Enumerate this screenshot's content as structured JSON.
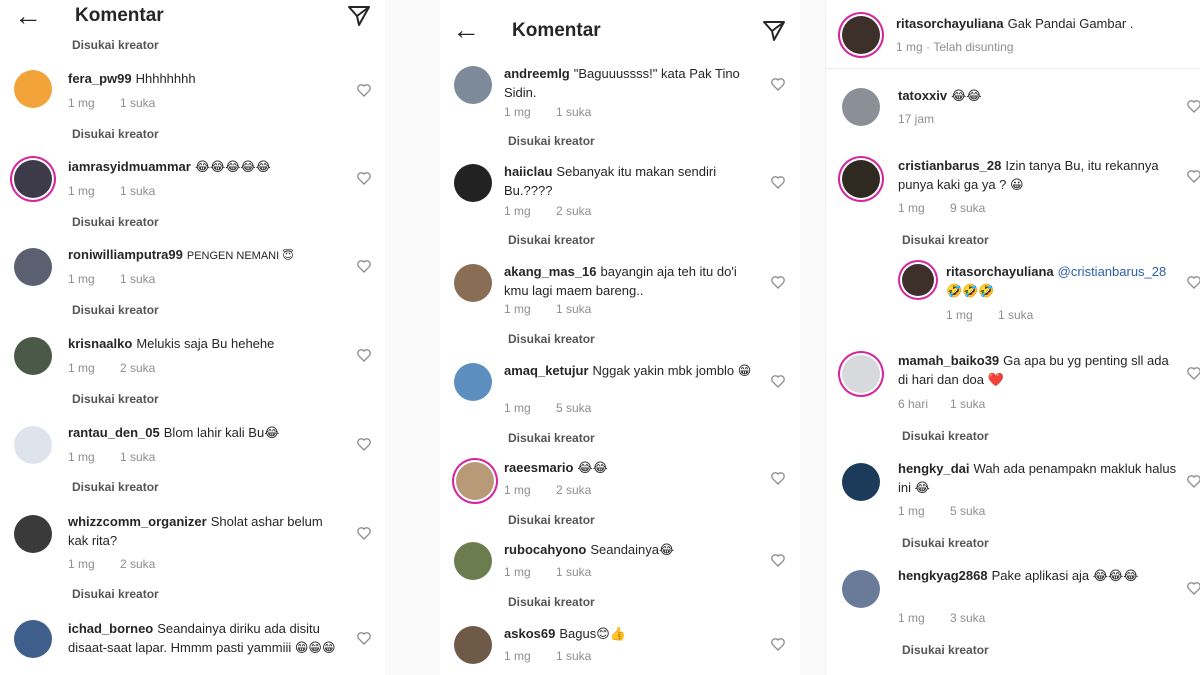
{
  "colors": {
    "text": "#262626",
    "muted": "#8e8e8e",
    "ring": "#d6249f"
  },
  "panel1": {
    "header": {
      "title": "Komentar",
      "back_icon": "arrow-left-icon",
      "send_icon": "send-icon"
    },
    "top_partial_label": "Disukai kreator",
    "comments": [
      {
        "username": "fera_pw99",
        "text": "Hhhhhhhh",
        "time": "1 mg",
        "likes": "1 suka",
        "liked_by_creator": "Disukai kreator"
      },
      {
        "username": "iamrasyidmuammar",
        "text": "😂😂😂😂😂",
        "time": "1 mg",
        "likes": "1 suka",
        "liked_by_creator": "Disukai kreator"
      },
      {
        "username": "roniwilliamputra99",
        "text": "PENGEN NEMANI 😇",
        "time": "1 mg",
        "likes": "1 suka",
        "liked_by_creator": "Disukai kreator"
      },
      {
        "username": "krisnaalko",
        "text": "Melukis saja Bu hehehe",
        "time": "1 mg",
        "likes": "2 suka",
        "liked_by_creator": "Disukai kreator"
      },
      {
        "username": "rantau_den_05",
        "text": "Blom lahir kali Bu😂",
        "time": "1 mg",
        "likes": "1 suka",
        "liked_by_creator": "Disukai kreator"
      },
      {
        "username": "whizzcomm_organizer",
        "text": "Sholat ashar belum kak rita?",
        "time": "1 mg",
        "likes": "2 suka",
        "liked_by_creator": "Disukai kreator"
      },
      {
        "username": "ichad_borneo",
        "text": "Seandainya diriku ada disitu disaat-saat lapar. Hmmm pasti yammiii 😁😁😁",
        "time": "",
        "likes": "",
        "liked_by_creator": ""
      }
    ]
  },
  "panel2": {
    "header": {
      "title": "Komentar",
      "back_icon": "arrow-left-icon",
      "send_icon": "send-icon"
    },
    "comments": [
      {
        "username": "andreemlg",
        "text": "\"Baguuussss!\" kata Pak Tino Sidin.",
        "time": "1 mg",
        "likes": "1 suka",
        "liked_by_creator": "Disukai kreator"
      },
      {
        "username": "haiiclau",
        "text": "Sebanyak itu makan sendiri Bu.????",
        "time": "1 mg",
        "likes": "2 suka",
        "liked_by_creator": "Disukai kreator"
      },
      {
        "username": "akang_mas_16",
        "text": "bayangin aja teh itu do'i kmu lagi maem bareng..",
        "time": "1 mg",
        "likes": "1 suka",
        "liked_by_creator": "Disukai kreator"
      },
      {
        "username": "amaq_ketujur",
        "text": "Nggak yakin mbk jomblo 😁",
        "time": "1 mg",
        "likes": "5 suka",
        "liked_by_creator": "Disukai kreator"
      },
      {
        "username": "raeesmario",
        "text": "😂😂",
        "time": "1 mg",
        "likes": "2 suka",
        "liked_by_creator": "Disukai kreator"
      },
      {
        "username": "rubocahyono",
        "text": "Seandainya😂",
        "time": "1 mg",
        "likes": "1 suka",
        "liked_by_creator": "Disukai kreator"
      },
      {
        "username": "askos69",
        "text": "Bagus😊👍",
        "time": "1 mg",
        "likes": "1 suka",
        "liked_by_creator": ""
      }
    ]
  },
  "panel3": {
    "comments": [
      {
        "username": "ritasorchayuliana",
        "text": "Gak Pandai Gambar .",
        "time": "1 mg",
        "likes": "",
        "edited": "Telah disunting",
        "liked_by_creator": ""
      },
      {
        "username": "tatoxxiv",
        "text": "😂😂",
        "time": "17 jam",
        "likes": "",
        "liked_by_creator": ""
      },
      {
        "username": "cristianbarus_28",
        "text": "Izin tanya Bu, itu rekannya punya kaki ga ya ? 😀",
        "time": "1 mg",
        "likes": "9 suka",
        "liked_by_creator": "Disukai kreator"
      },
      {
        "username": "ritasorchayuliana",
        "text": "@cristianbarus_28 🤣🤣🤣",
        "time": "1 mg",
        "likes": "1 suka",
        "liked_by_creator": ""
      },
      {
        "username": "mamah_baiko39",
        "text": "Ga apa bu  yg penting sll ada di hari dan doa ❤️",
        "time": "6 hari",
        "likes": "1 suka",
        "liked_by_creator": "Disukai kreator"
      },
      {
        "username": "hengky_dai",
        "text": "Wah ada penampakn makluk halus ini 😂",
        "time": "1 mg",
        "likes": "5 suka",
        "liked_by_creator": "Disukai kreator"
      },
      {
        "username": "hengkyag2868",
        "text": "Pake aplikasi aja 😂😂😂",
        "time": "1 mg",
        "likes": "3 suka",
        "liked_by_creator": "Disukai kreator"
      }
    ]
  }
}
